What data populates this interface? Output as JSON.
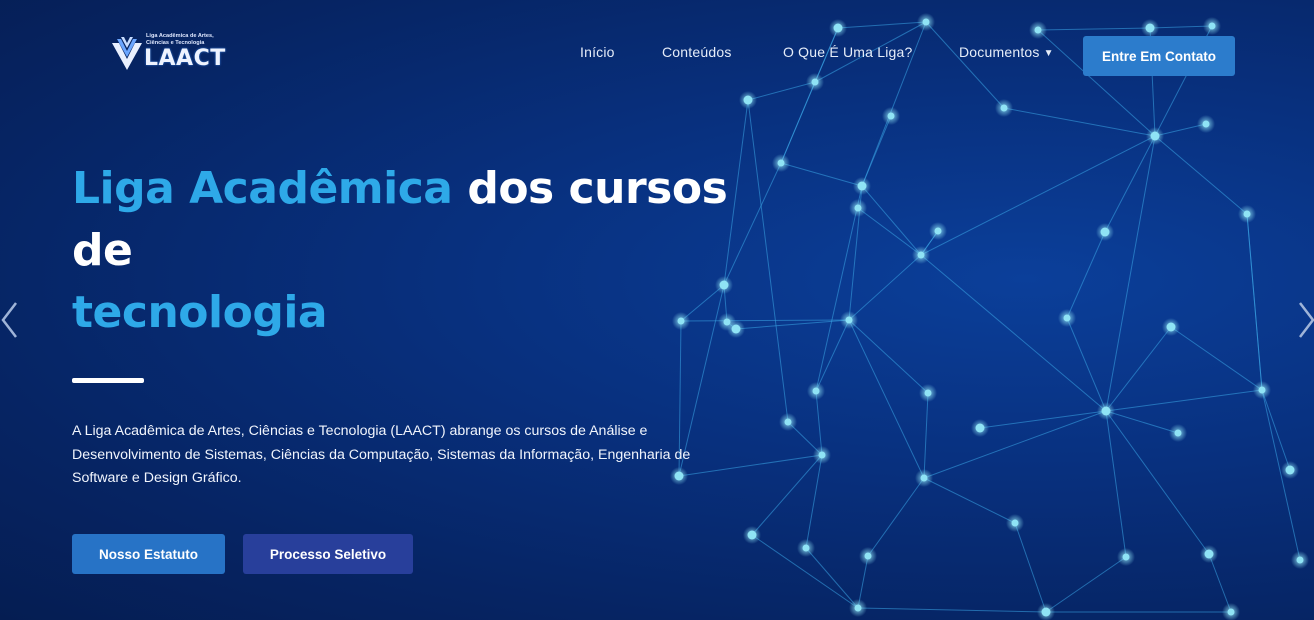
{
  "brand": {
    "logo_text": "LAACT",
    "logo_subtitle": "Liga Acadêmica de Artes, Ciências e Tecnologia",
    "logo_icon": "v-chevron-logo-icon"
  },
  "nav": {
    "items": [
      {
        "label": "Início"
      },
      {
        "label": "Conteúdos"
      },
      {
        "label": "O Que É Uma Liga?"
      },
      {
        "label": "Documentos",
        "has_dropdown": true
      }
    ],
    "cta_label": "Entre Em Contato"
  },
  "hero": {
    "title_part1": "Liga Acadêmica",
    "title_part2": " dos cursos",
    "title_part3": "de",
    "title_part4": "tecnologia",
    "description": "A Liga Acadêmica de Artes, Ciências e Tecnologia (LAACT) abrange os cursos de Análise e Desenvolvimento de Sistemas, Ciências da Computação, Sistemas da Informação, Engenharia de Software e Design Gráfico.",
    "buttons": [
      {
        "label": "Nosso Estatuto"
      },
      {
        "label": "Processo Seletivo"
      }
    ]
  },
  "carousel": {
    "prev_icon": "chevron-left-icon",
    "next_icon": "chevron-right-icon"
  },
  "colors": {
    "background": "#062463",
    "accent": "#2ea9e8",
    "cta_button": "#2c7ccc",
    "secondary_button": "#283f9b",
    "network_node": "#8fe3f5"
  }
}
